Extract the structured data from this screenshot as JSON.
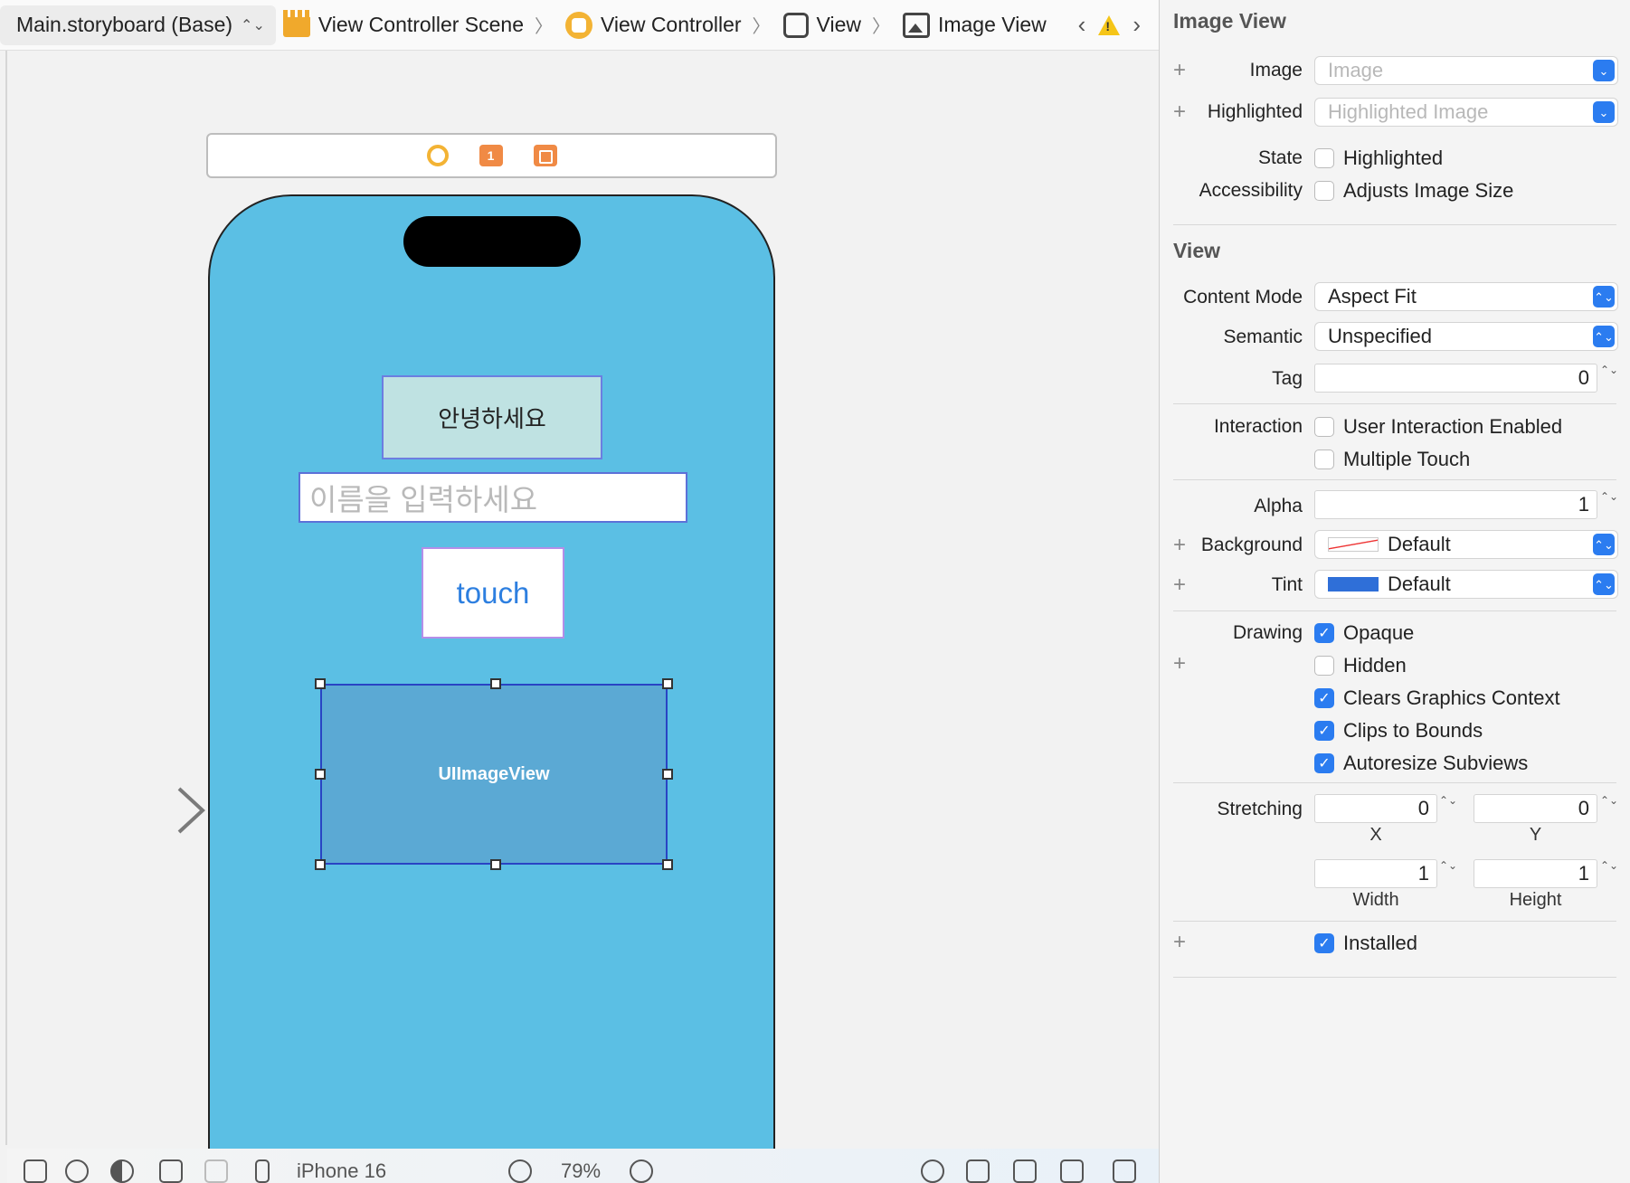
{
  "jumpbar": {
    "crumbs": [
      "Main.storyboard (Base)",
      "View Controller Scene",
      "View Controller",
      "View",
      "Image View"
    ],
    "back_glyph": "‹",
    "forward_glyph": "›",
    "warning_glyph": "!"
  },
  "scene_dock": {
    "first_responder_badge": "1"
  },
  "phone": {
    "hello_label": "안녕하세요",
    "name_placeholder": "이름을 입력하세요",
    "touch_button": "touch",
    "image_view_label": "UIImageView",
    "background_color": "#5bbfe4"
  },
  "bottom_bar": {
    "device": "iPhone 16",
    "zoom": "79%"
  },
  "inspector": {
    "image_view_title": "Image View",
    "image_label": "Image",
    "image_placeholder": "Image",
    "highlighted_label": "Highlighted",
    "highlighted_placeholder": "Highlighted Image",
    "state_label": "State",
    "state_highlighted": "Highlighted",
    "accessibility_label": "Accessibility",
    "adjusts_image_size": "Adjusts Image Size",
    "view_title": "View",
    "content_mode_label": "Content Mode",
    "content_mode_value": "Aspect Fit",
    "semantic_label": "Semantic",
    "semantic_value": "Unspecified",
    "tag_label": "Tag",
    "tag_value": "0",
    "interaction_label": "Interaction",
    "user_interaction_enabled": "User Interaction Enabled",
    "multiple_touch": "Multiple Touch",
    "alpha_label": "Alpha",
    "alpha_value": "1",
    "background_label": "Background",
    "background_value": "Default",
    "tint_label": "Tint",
    "tint_value": "Default",
    "tint_color": "#2f6fd8",
    "drawing_label": "Drawing",
    "opaque": "Opaque",
    "hidden": "Hidden",
    "clears_graphics_context": "Clears Graphics Context",
    "clips_to_bounds": "Clips to Bounds",
    "autoresize_subviews": "Autoresize Subviews",
    "stretching_label": "Stretching",
    "stretch_x_value": "0",
    "stretch_y_value": "0",
    "stretch_width_value": "1",
    "stretch_height_value": "1",
    "x_label": "X",
    "y_label": "Y",
    "width_label": "Width",
    "height_label": "Height",
    "installed": "Installed",
    "plus_glyph": "+",
    "popup_caret": "⌃⌄",
    "stepper_glyph": "⌃⌄",
    "check_glyph": "✓"
  },
  "accent_color": "#2b7cf0"
}
